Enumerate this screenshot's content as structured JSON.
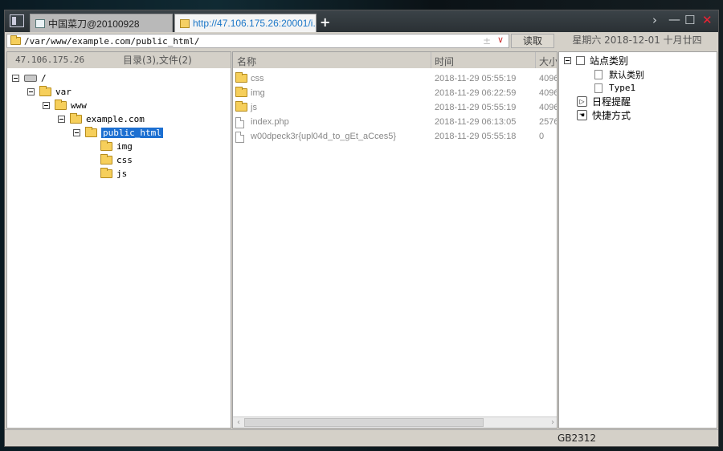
{
  "tabs": [
    {
      "label": "中国菜刀@20100928",
      "active": false
    },
    {
      "label": "http://47.106.175.26:20001/i...",
      "active": true
    }
  ],
  "titlebar": {
    "new_tab": "+",
    "chevron": "›",
    "minimize": "—",
    "maximize": "☐",
    "close": "✕"
  },
  "address": {
    "path": "/var/www/example.com/public_html/",
    "pm": "±",
    "dropdown": "∨"
  },
  "read_button": "读取",
  "date_display": "星期六 2018-12-01 十月廿四",
  "left_panel": {
    "ip": "47.106.175.26",
    "summary": "目录(3),文件(2)",
    "tree": [
      {
        "label": "/",
        "depth": 0,
        "icon": "drive",
        "expander": true
      },
      {
        "label": "var",
        "depth": 1,
        "icon": "folder",
        "expander": true
      },
      {
        "label": "www",
        "depth": 2,
        "icon": "folder",
        "expander": true
      },
      {
        "label": "example.com",
        "depth": 3,
        "icon": "folder",
        "expander": true
      },
      {
        "label": "public_html",
        "depth": 4,
        "icon": "folder",
        "expander": true,
        "selected": true
      },
      {
        "label": "img",
        "depth": 5,
        "icon": "folder",
        "expander": false
      },
      {
        "label": "css",
        "depth": 5,
        "icon": "folder",
        "expander": false
      },
      {
        "label": "js",
        "depth": 5,
        "icon": "folder",
        "expander": false
      }
    ]
  },
  "file_list": {
    "columns": {
      "name": "名称",
      "time": "时间",
      "size": "大小"
    },
    "rows": [
      {
        "name": "css",
        "time": "2018-11-29 05:55:19",
        "size": "4096",
        "type": "folder"
      },
      {
        "name": "img",
        "time": "2018-11-29 06:22:59",
        "size": "4096",
        "type": "folder"
      },
      {
        "name": "js",
        "time": "2018-11-29 05:55:19",
        "size": "4096",
        "type": "folder"
      },
      {
        "name": "index.php",
        "time": "2018-11-29 06:13:05",
        "size": "2576",
        "type": "file"
      },
      {
        "name": "w00dpeck3r{upl04d_to_gEt_aCces5}",
        "time": "2018-11-29 05:55:18",
        "size": "0",
        "type": "file"
      }
    ]
  },
  "right_panel": {
    "items": [
      {
        "label": "站点类别",
        "kind": "checkbox",
        "expander": true
      },
      {
        "label": "默认类别",
        "kind": "page"
      },
      {
        "label": "Type1",
        "kind": "page"
      },
      {
        "label": "日程提醒",
        "kind": "clock"
      },
      {
        "label": "快捷方式",
        "kind": "hand"
      }
    ]
  },
  "status": {
    "encoding": "GB2312"
  }
}
